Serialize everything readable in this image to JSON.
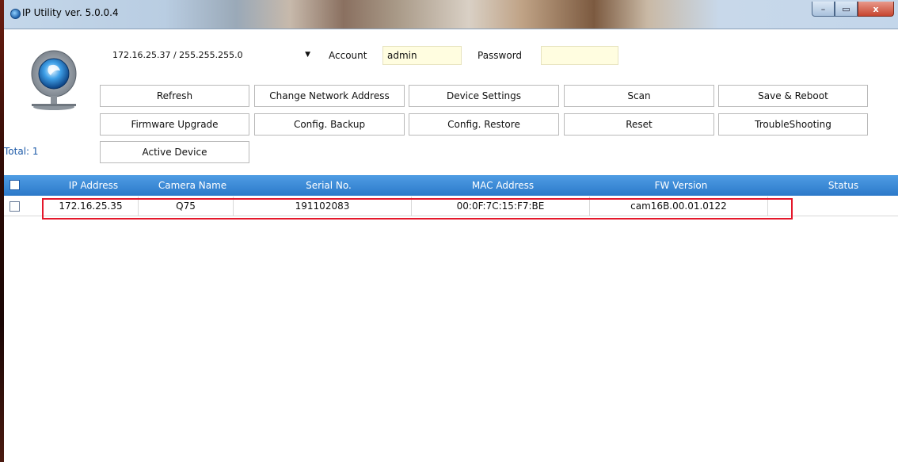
{
  "window": {
    "title": "IP Utility ver. 5.0.0.4",
    "controls": [
      "–",
      "▭",
      "x"
    ]
  },
  "network": {
    "selected": "172.16.25.37 / 255.255.255.0"
  },
  "account": {
    "label": "Account",
    "value": "admin"
  },
  "password": {
    "label": "Password",
    "value": ""
  },
  "buttons": {
    "refresh": "Refresh",
    "change_network_address": "Change Network Address",
    "device_settings": "Device Settings",
    "scan": "Scan",
    "save_reboot": "Save & Reboot",
    "firmware_upgrade": "Firmware Upgrade",
    "config_backup": "Config. Backup",
    "config_restore": "Config. Restore",
    "reset": "Reset",
    "troubleshooting": "TroubleShooting",
    "active_device": "Active Device"
  },
  "total": "Total: 1",
  "table": {
    "columns": [
      "IP Address",
      "Camera Name",
      "Serial No.",
      "MAC Address",
      "FW Version",
      "Status"
    ],
    "rows": [
      {
        "ip": "172.16.25.35",
        "name": "Q75",
        "serial": "191102083",
        "mac": "00:0F:7C:15:F7:BE",
        "fw": "cam16B.00.01.0122",
        "status": ""
      }
    ]
  },
  "colors": {
    "header_blue": "#3a8ad8",
    "highlight": "#e4172b",
    "field_bg": "#fffde0",
    "total_text": "#1d5aa8"
  }
}
